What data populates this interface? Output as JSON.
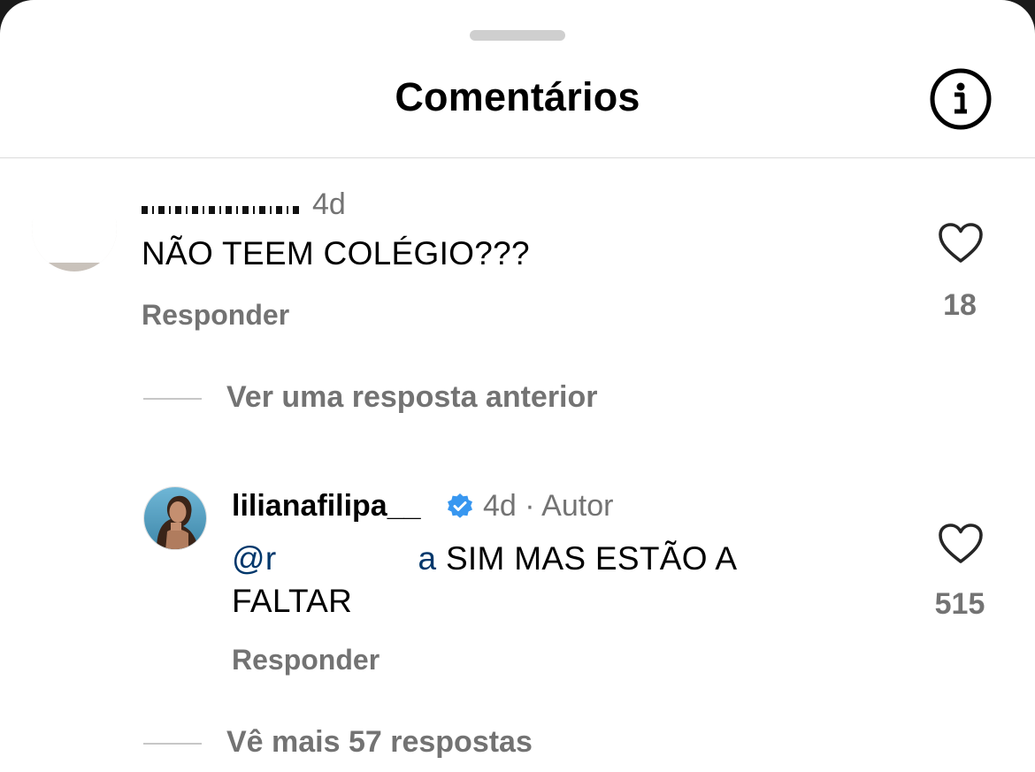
{
  "header": {
    "title": "Comentários",
    "info_icon": "info-circle-icon"
  },
  "comments": [
    {
      "username": "",
      "time": "4d",
      "text": "NÃO TEEM COLÉGIO???",
      "reply_label": "Responder",
      "like_icon": "heart-outline-icon",
      "like_count": "18",
      "view_replies_label": "Ver uma resposta anterior"
    }
  ],
  "reply": {
    "username": "lilianafilipa__",
    "verified_icon": "verified-badge-icon",
    "meta": "4d · Autor",
    "mention_start": "@r",
    "mention_end": "a",
    "text": " SIM MAS ESTÃO A FALTAR",
    "reply_label": "Responder",
    "like_icon": "heart-outline-icon",
    "like_count": "515"
  },
  "footer": {
    "view_more_label": "Vê mais 57 respostas"
  },
  "colors": {
    "text_primary": "#000000",
    "text_secondary": "#737373",
    "mention": "#00376b",
    "verified": "#0095f6",
    "divider": "#dbdbdb"
  }
}
